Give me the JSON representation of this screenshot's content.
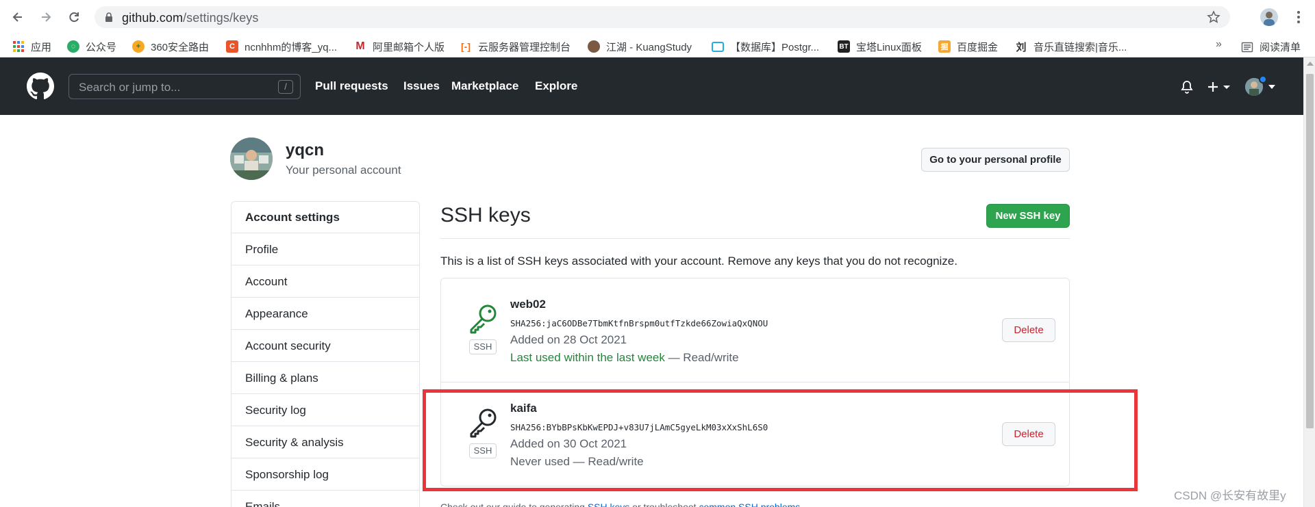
{
  "browser": {
    "url_host": "github.com",
    "url_path": "/settings/keys",
    "bookmarks": [
      {
        "label": "应用",
        "icon": "apps-grid-icon",
        "color": "#ea4335"
      },
      {
        "label": "公众号",
        "icon": "wechat-icon",
        "color": "#2aae67"
      },
      {
        "label": "360安全路由",
        "icon": "360-icon",
        "color": "#f9a825"
      },
      {
        "label": "ncnhhm的博客_yq...",
        "icon": "csdn-icon",
        "color": "#e8552b"
      },
      {
        "label": "阿里邮箱个人版",
        "icon": "mail-icon",
        "color": "#c62828"
      },
      {
        "label": "云服务器管理控制台",
        "icon": "aliyun-icon",
        "color": "#ff6a00"
      },
      {
        "label": "江湖 - KuangStudy",
        "icon": "kuang-icon",
        "color": "#7b5a44"
      },
      {
        "label": "【数据库】Postgr...",
        "icon": "bilibili-icon",
        "color": "#23ade5"
      },
      {
        "label": "宝塔Linux面板",
        "icon": "bt-icon",
        "color": "#222222"
      },
      {
        "label": "百度掘金",
        "icon": "juejin-icon",
        "color": "#f4a732"
      },
      {
        "label": "音乐直链搜索|音乐...",
        "icon": "music-icon",
        "color": "#333333"
      }
    ],
    "more": "»",
    "reading_list": "阅读清单"
  },
  "header": {
    "search_placeholder": "Search or jump to...",
    "slash": "/",
    "nav": [
      "Pull requests",
      "Issues",
      "Marketplace",
      "Explore"
    ]
  },
  "user": {
    "name": "yqcn",
    "subtitle": "Your personal account",
    "profile_button": "Go to your personal profile"
  },
  "menu": {
    "heading": "Account settings",
    "items": [
      "Profile",
      "Account",
      "Appearance",
      "Account security",
      "Billing & plans",
      "Security log",
      "Security & analysis",
      "Sponsorship log",
      "Emails"
    ]
  },
  "ssh": {
    "title": "SSH keys",
    "new_button": "New SSH key",
    "intro": "This is a list of SSH keys associated with your account. Remove any keys that you do not recognize.",
    "badge": "SSH",
    "delete_label": "Delete",
    "keys": [
      {
        "name": "web02",
        "fingerprint": "SHA256:jaC6ODBe7TbmKtfnBrspm0utfTzkde66ZowiaQxQNOU",
        "added": "Added on 28 Oct 2021",
        "used_status": "Last used within the last week",
        "access": " — Read/write",
        "icon_color": "#22863a"
      },
      {
        "name": "kaifa",
        "fingerprint": "SHA256:BYbBPsKbKwEPDJ+v83U7jLAmC5gyeLkM03xXxShL6S0",
        "added": "Added on 30 Oct 2021",
        "used_status": "Never used",
        "access": " — Read/write",
        "icon_color": "#24292e"
      }
    ]
  },
  "footer": {
    "prefix": "Check out our guide to generating ",
    "link1": "SSH keys",
    "middle": " or troubleshoot ",
    "link2": "common SSH problems",
    "suffix": "."
  },
  "watermark": "CSDN @长安有故里y",
  "colors": {
    "header_bg": "#24292e",
    "primary_green": "#2ea44f",
    "danger_red": "#cb2431",
    "highlight_red": "#e8363b"
  }
}
